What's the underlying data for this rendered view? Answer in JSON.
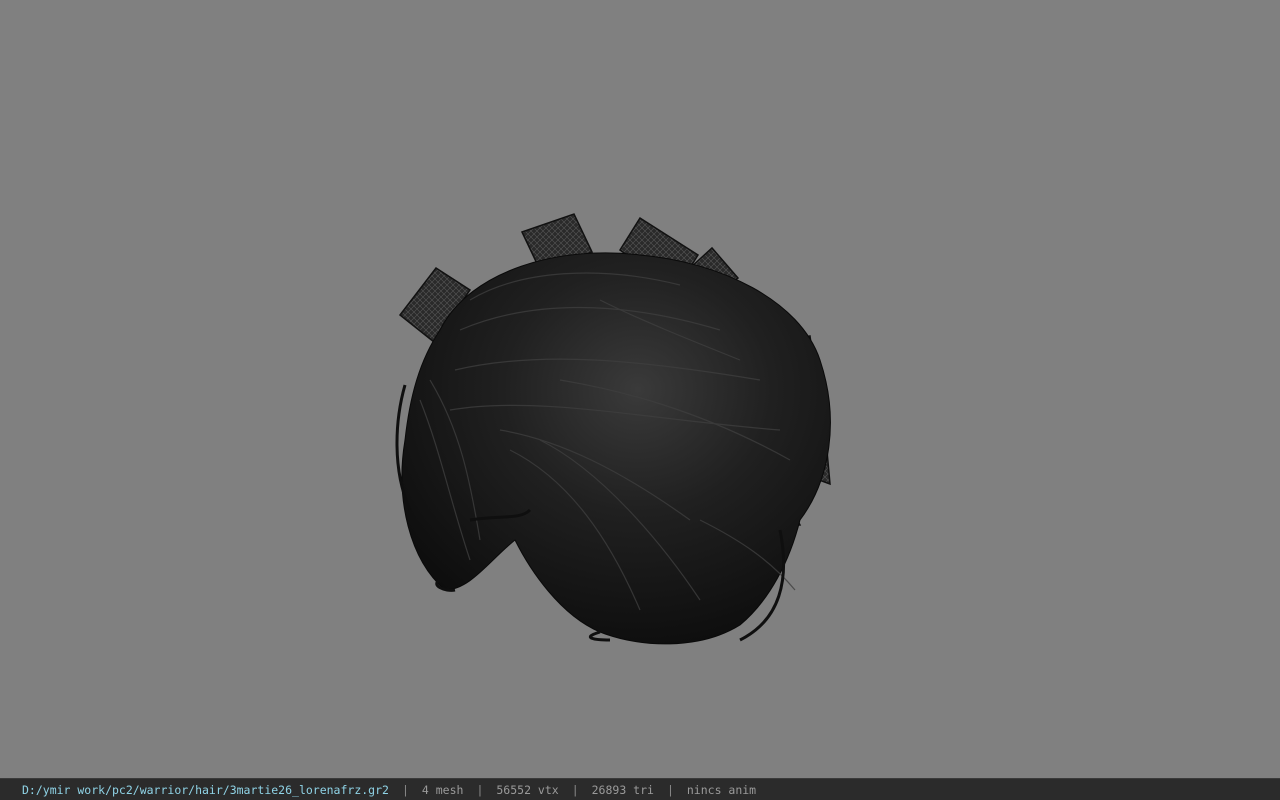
{
  "viewport": {
    "background": "#808080",
    "model_name": "hair-model",
    "model_color": "#141414"
  },
  "status_bar": {
    "path": "D:/ymir work/pc2/warrior/hair/3martie26_lorenafrz.gr2",
    "separator": "|",
    "mesh": "4 mesh",
    "vtx": "56552 vtx",
    "tri": "26893 tri",
    "anim": "nincs anim",
    "path_color": "#8fd3e6"
  }
}
